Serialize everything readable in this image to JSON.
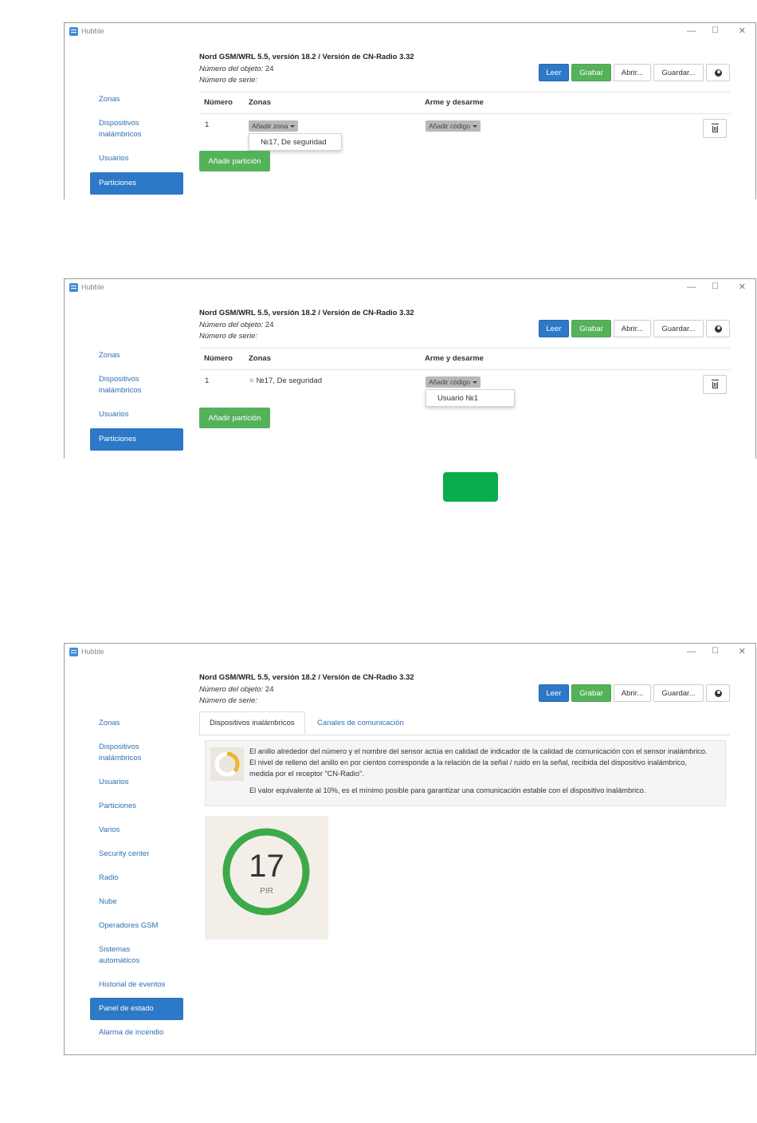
{
  "app": {
    "title": "Hubble",
    "window_controls": {
      "minimize": "—",
      "maximize": "☐",
      "close": "✕"
    }
  },
  "header": {
    "device_title": "Nord GSM/WRL 5.5, versión 18.2 / Versión de CN-Radio 3.32",
    "object_number_label": "Número del objeto:",
    "object_number_value": "24",
    "serial_label": "Número de serie:"
  },
  "toolbar": {
    "read": "Leer",
    "write": "Grabar",
    "open": "Abrir...",
    "save": "Guardar...",
    "globe_icon": "globe-icon"
  },
  "sidebar_short": {
    "items": [
      "Zonas",
      "Dispositivos\ninalámbricos",
      "Usuarios",
      "Particiones"
    ],
    "active": "Particiones"
  },
  "partitions_table": {
    "columns": [
      "Número",
      "Zonas",
      "Arme y desarme"
    ],
    "row_number": "1",
    "add_zone": "Añadir zona",
    "add_code": "Añadir código",
    "add_partition": "Añadir partición"
  },
  "screen1": {
    "zone_dropdown_option": "№17, De seguridad"
  },
  "screen2": {
    "assigned_zone": "№17, De seguridad",
    "remove_icon": "✕",
    "code_dropdown_option": "Usuario №1"
  },
  "screen3": {
    "sidebar": {
      "items": [
        "Zonas",
        "Dispositivos\ninalámbricos",
        "Usuarios",
        "Particiones",
        "Varios",
        "Security center",
        "Radio",
        "Nube",
        "Operadores GSM",
        "Sistemas\nautomáticos",
        "Historial de eventos",
        "Panel de estado",
        "Alarma de incendio"
      ],
      "active": "Panel de estado"
    },
    "tabs": [
      "Dispositivos inalámbricos",
      "Canales de comunicación"
    ],
    "info": {
      "p1": "El anillo alrededor del número y el nombre del sensor actúa en calidad de indicador de la calidad de comunicación con el sensor inalámbrico. El nivel de relleno del anillo en por cientos corresponde a la relación de la señal / ruido en la señal, recibida del dispositivo inalámbrico, medida por el receptor \"CN-Radio\".",
      "p2": "El valor equivalente al 10%, es el mínimo posible para garantizar una comunicación estable con el dispositivo inalámbrico."
    },
    "sensor": {
      "number": "17",
      "type": "PIR",
      "signal_fraction": 1.0
    }
  },
  "colors": {
    "primary": "#2d78c7",
    "success": "#55b25b",
    "ring": "#3daa4a",
    "info_ring": "#e8b631",
    "green_mark": "#0aad4b"
  }
}
